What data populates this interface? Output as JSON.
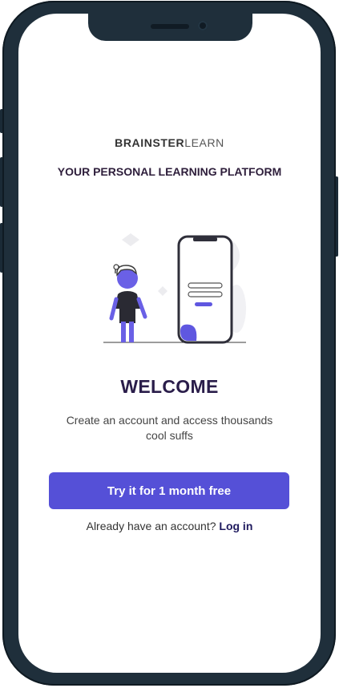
{
  "colors": {
    "frame": "#1f2f3b",
    "accent": "#5550d7",
    "heading": "#2a1d4a",
    "link": "#1f1a5e"
  },
  "brand": {
    "strong": "BRAINSTER",
    "light": "LEARN"
  },
  "tagline": "YOUR PERSONAL LEARNING PLATFORM",
  "illustration": {
    "icon": "person-with-phone-illustration"
  },
  "welcome": {
    "title": "WELCOME",
    "subtitle": "Create an account and access thousands cool suffs"
  },
  "cta": {
    "label": "Try it for 1 month free"
  },
  "login": {
    "prompt": "Already have an account?",
    "link_label": "Log in"
  }
}
